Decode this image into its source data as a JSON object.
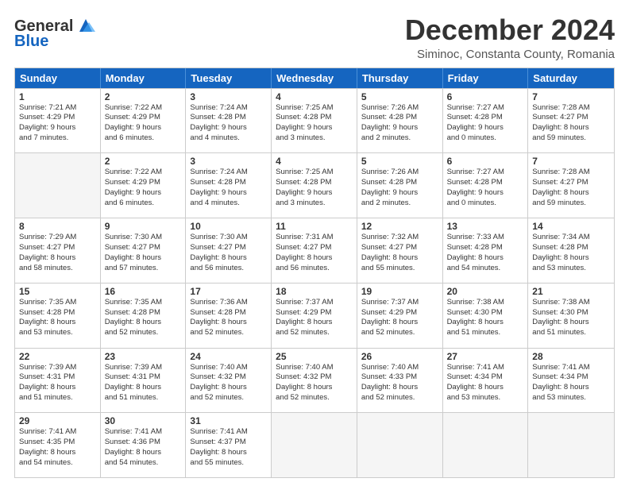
{
  "header": {
    "logo_line1": "General",
    "logo_line2": "Blue",
    "title": "December 2024",
    "subtitle": "Siminoc, Constanta County, Romania"
  },
  "calendar": {
    "days_of_week": [
      "Sunday",
      "Monday",
      "Tuesday",
      "Wednesday",
      "Thursday",
      "Friday",
      "Saturday"
    ],
    "weeks": [
      [
        {
          "day": "",
          "empty": true,
          "lines": []
        },
        {
          "day": "2",
          "lines": [
            "Sunrise: 7:22 AM",
            "Sunset: 4:29 PM",
            "Daylight: 9 hours",
            "and 6 minutes."
          ]
        },
        {
          "day": "3",
          "lines": [
            "Sunrise: 7:24 AM",
            "Sunset: 4:28 PM",
            "Daylight: 9 hours",
            "and 4 minutes."
          ]
        },
        {
          "day": "4",
          "lines": [
            "Sunrise: 7:25 AM",
            "Sunset: 4:28 PM",
            "Daylight: 9 hours",
            "and 3 minutes."
          ]
        },
        {
          "day": "5",
          "lines": [
            "Sunrise: 7:26 AM",
            "Sunset: 4:28 PM",
            "Daylight: 9 hours",
            "and 2 minutes."
          ]
        },
        {
          "day": "6",
          "lines": [
            "Sunrise: 7:27 AM",
            "Sunset: 4:28 PM",
            "Daylight: 9 hours",
            "and 0 minutes."
          ]
        },
        {
          "day": "7",
          "lines": [
            "Sunrise: 7:28 AM",
            "Sunset: 4:27 PM",
            "Daylight: 8 hours",
            "and 59 minutes."
          ]
        }
      ],
      [
        {
          "day": "8",
          "lines": [
            "Sunrise: 7:29 AM",
            "Sunset: 4:27 PM",
            "Daylight: 8 hours",
            "and 58 minutes."
          ]
        },
        {
          "day": "9",
          "lines": [
            "Sunrise: 7:30 AM",
            "Sunset: 4:27 PM",
            "Daylight: 8 hours",
            "and 57 minutes."
          ]
        },
        {
          "day": "10",
          "lines": [
            "Sunrise: 7:30 AM",
            "Sunset: 4:27 PM",
            "Daylight: 8 hours",
            "and 56 minutes."
          ]
        },
        {
          "day": "11",
          "lines": [
            "Sunrise: 7:31 AM",
            "Sunset: 4:27 PM",
            "Daylight: 8 hours",
            "and 56 minutes."
          ]
        },
        {
          "day": "12",
          "lines": [
            "Sunrise: 7:32 AM",
            "Sunset: 4:27 PM",
            "Daylight: 8 hours",
            "and 55 minutes."
          ]
        },
        {
          "day": "13",
          "lines": [
            "Sunrise: 7:33 AM",
            "Sunset: 4:28 PM",
            "Daylight: 8 hours",
            "and 54 minutes."
          ]
        },
        {
          "day": "14",
          "lines": [
            "Sunrise: 7:34 AM",
            "Sunset: 4:28 PM",
            "Daylight: 8 hours",
            "and 53 minutes."
          ]
        }
      ],
      [
        {
          "day": "15",
          "lines": [
            "Sunrise: 7:35 AM",
            "Sunset: 4:28 PM",
            "Daylight: 8 hours",
            "and 53 minutes."
          ]
        },
        {
          "day": "16",
          "lines": [
            "Sunrise: 7:35 AM",
            "Sunset: 4:28 PM",
            "Daylight: 8 hours",
            "and 52 minutes."
          ]
        },
        {
          "day": "17",
          "lines": [
            "Sunrise: 7:36 AM",
            "Sunset: 4:28 PM",
            "Daylight: 8 hours",
            "and 52 minutes."
          ]
        },
        {
          "day": "18",
          "lines": [
            "Sunrise: 7:37 AM",
            "Sunset: 4:29 PM",
            "Daylight: 8 hours",
            "and 52 minutes."
          ]
        },
        {
          "day": "19",
          "lines": [
            "Sunrise: 7:37 AM",
            "Sunset: 4:29 PM",
            "Daylight: 8 hours",
            "and 52 minutes."
          ]
        },
        {
          "day": "20",
          "lines": [
            "Sunrise: 7:38 AM",
            "Sunset: 4:30 PM",
            "Daylight: 8 hours",
            "and 51 minutes."
          ]
        },
        {
          "day": "21",
          "lines": [
            "Sunrise: 7:38 AM",
            "Sunset: 4:30 PM",
            "Daylight: 8 hours",
            "and 51 minutes."
          ]
        }
      ],
      [
        {
          "day": "22",
          "lines": [
            "Sunrise: 7:39 AM",
            "Sunset: 4:31 PM",
            "Daylight: 8 hours",
            "and 51 minutes."
          ]
        },
        {
          "day": "23",
          "lines": [
            "Sunrise: 7:39 AM",
            "Sunset: 4:31 PM",
            "Daylight: 8 hours",
            "and 51 minutes."
          ]
        },
        {
          "day": "24",
          "lines": [
            "Sunrise: 7:40 AM",
            "Sunset: 4:32 PM",
            "Daylight: 8 hours",
            "and 52 minutes."
          ]
        },
        {
          "day": "25",
          "lines": [
            "Sunrise: 7:40 AM",
            "Sunset: 4:32 PM",
            "Daylight: 8 hours",
            "and 52 minutes."
          ]
        },
        {
          "day": "26",
          "lines": [
            "Sunrise: 7:40 AM",
            "Sunset: 4:33 PM",
            "Daylight: 8 hours",
            "and 52 minutes."
          ]
        },
        {
          "day": "27",
          "lines": [
            "Sunrise: 7:41 AM",
            "Sunset: 4:34 PM",
            "Daylight: 8 hours",
            "and 53 minutes."
          ]
        },
        {
          "day": "28",
          "lines": [
            "Sunrise: 7:41 AM",
            "Sunset: 4:34 PM",
            "Daylight: 8 hours",
            "and 53 minutes."
          ]
        }
      ],
      [
        {
          "day": "29",
          "lines": [
            "Sunrise: 7:41 AM",
            "Sunset: 4:35 PM",
            "Daylight: 8 hours",
            "and 54 minutes."
          ]
        },
        {
          "day": "30",
          "lines": [
            "Sunrise: 7:41 AM",
            "Sunset: 4:36 PM",
            "Daylight: 8 hours",
            "and 54 minutes."
          ]
        },
        {
          "day": "31",
          "lines": [
            "Sunrise: 7:41 AM",
            "Sunset: 4:37 PM",
            "Daylight: 8 hours",
            "and 55 minutes."
          ]
        },
        {
          "day": "",
          "empty": true,
          "lines": []
        },
        {
          "day": "",
          "empty": true,
          "lines": []
        },
        {
          "day": "",
          "empty": true,
          "lines": []
        },
        {
          "day": "",
          "empty": true,
          "lines": []
        }
      ]
    ],
    "first_week": [
      {
        "day": "1",
        "lines": [
          "Sunrise: 7:21 AM",
          "Sunset: 4:29 PM",
          "Daylight: 9 hours",
          "and 7 minutes."
        ]
      }
    ]
  }
}
